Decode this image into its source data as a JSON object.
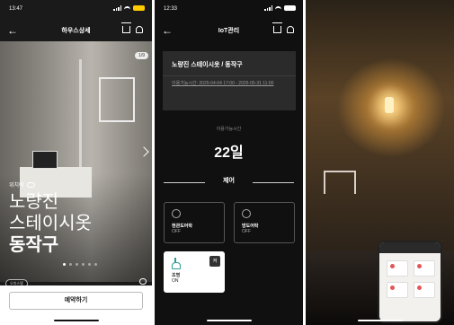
{
  "screen1": {
    "status_time": "13:47",
    "nav_title": "하우스상세",
    "photo_counter": "1/9",
    "tag_text": "위치에",
    "title_lines": [
      "노량진",
      "스테이시옷",
      "동작구"
    ],
    "chip_text": "오피스텔",
    "reserve_label": "예약하기"
  },
  "screen2": {
    "status_time": "12:33",
    "nav_title": "IoT관리",
    "address": "노량진 스테이시옷 / 동작구",
    "period_text": "이용가능시간: 2025-04-04 17:00 - 2025-05-31 11:00",
    "remaining_label": "이용가능시간",
    "remaining_value": "22일",
    "control_label": "제어",
    "controls": [
      {
        "name": "현관도어락",
        "state": "OFF"
      },
      {
        "name": "방도어락",
        "state": "OFF"
      },
      {
        "name": "조명",
        "state": "ON",
        "extra": "켜"
      }
    ]
  },
  "colors": {
    "accent_green": "#2a9d8f",
    "battery_yellow": "#ffcc00"
  }
}
